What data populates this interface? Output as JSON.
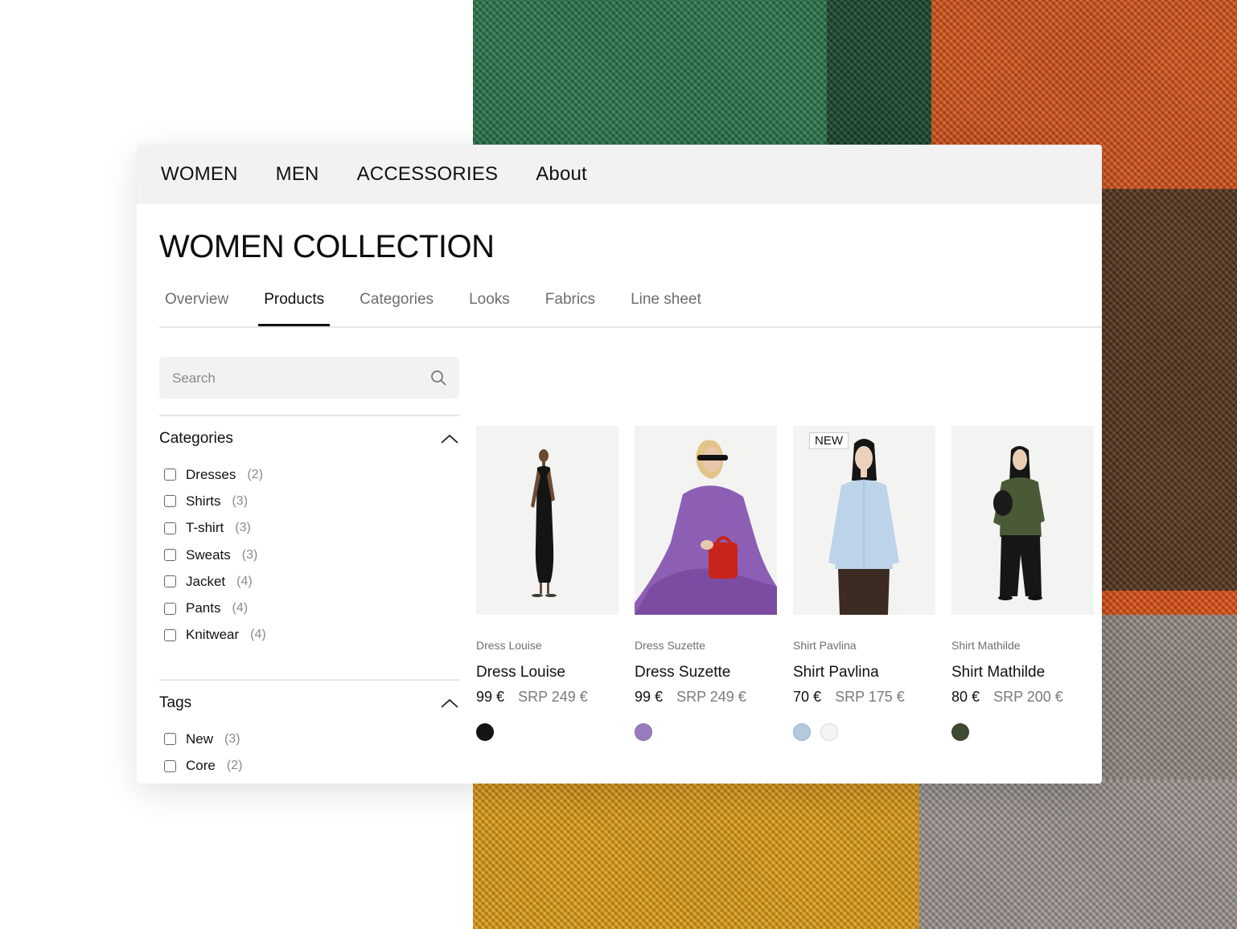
{
  "nav": {
    "items": [
      "WOMEN",
      "MEN",
      "ACCESSORIES",
      "About"
    ]
  },
  "page": {
    "title": "WOMEN COLLECTION"
  },
  "tabs": [
    "Overview",
    "Products",
    "Categories",
    "Looks",
    "Fabrics",
    "Line sheet"
  ],
  "active_tab": "Products",
  "search": {
    "placeholder": "Search"
  },
  "filters": {
    "categories": {
      "title": "Categories",
      "options": [
        {
          "label": "Dresses",
          "count": "(2)"
        },
        {
          "label": "Shirts",
          "count": "(3)"
        },
        {
          "label": "T-shirt",
          "count": "(3)"
        },
        {
          "label": "Sweats",
          "count": "(3)"
        },
        {
          "label": "Jacket",
          "count": "(4)"
        },
        {
          "label": "Pants",
          "count": "(4)"
        },
        {
          "label": "Knitwear",
          "count": "(4)"
        }
      ]
    },
    "tags": {
      "title": "Tags",
      "options": [
        {
          "label": "New",
          "count": "(3)"
        },
        {
          "label": "Core",
          "count": "(2)"
        }
      ]
    }
  },
  "products": [
    {
      "subtitle": "Dress Louise",
      "name": "Dress Louise",
      "price": "99 €",
      "srp": "SRP 249 €",
      "badge": "",
      "colors": [
        "#141414"
      ]
    },
    {
      "subtitle": "Dress Suzette",
      "name": "Dress Suzette",
      "price": "99 €",
      "srp": "SRP 249 €",
      "badge": "",
      "colors": [
        "#9a7bbd"
      ]
    },
    {
      "subtitle": "Shirt Pavlina",
      "name": "Shirt Pavlina",
      "price": "70 €",
      "srp": "SRP 175 €",
      "badge": "NEW",
      "colors": [
        "#b3c9de",
        "#f4f4f4"
      ]
    },
    {
      "subtitle": "Shirt Mathilde",
      "name": "Shirt Mathilde",
      "price": "80 €",
      "srp": "SRP 200 €",
      "badge": "",
      "colors": [
        "#3f4a34"
      ]
    }
  ],
  "theme": {
    "nav_bg": "#f2f2f2",
    "accent": "#111111"
  }
}
